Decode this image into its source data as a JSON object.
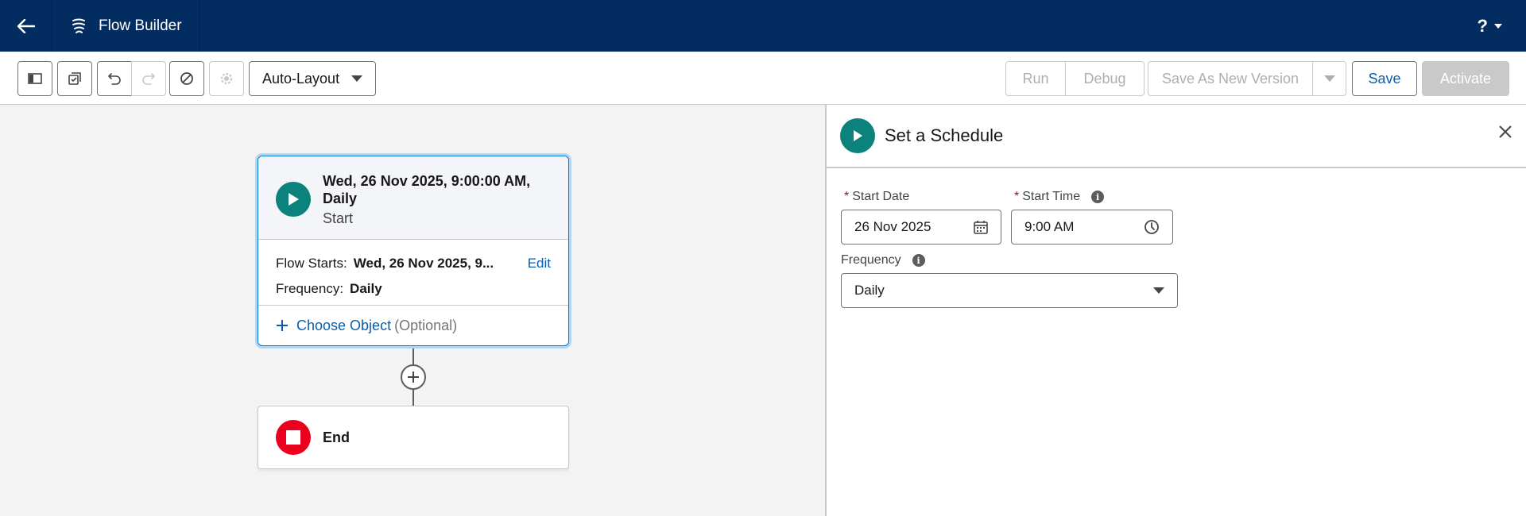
{
  "header": {
    "title": "Flow Builder",
    "help_label": "?"
  },
  "toolbar": {
    "layout_mode": "Auto-Layout",
    "run_label": "Run",
    "debug_label": "Debug",
    "save_as_new_label": "Save As New Version",
    "save_label": "Save",
    "activate_label": "Activate"
  },
  "canvas": {
    "start_card": {
      "title": "Wed, 26 Nov 2025, 9:00:00 AM, Daily",
      "subtitle": "Start",
      "flow_starts_label": "Flow Starts:",
      "flow_starts_value": "Wed, 26 Nov 2025, 9...",
      "edit_label": "Edit",
      "frequency_label": "Frequency:",
      "frequency_value": "Daily",
      "choose_object_label": "Choose Object",
      "choose_object_optional": "(Optional)"
    },
    "end_card": {
      "label": "End"
    }
  },
  "panel": {
    "title": "Set a Schedule",
    "start_date_label": "Start Date",
    "start_date_value": "26 Nov 2025",
    "start_time_label": "Start Time",
    "start_time_value": "9:00 AM",
    "frequency_label": "Frequency",
    "frequency_value": "Daily",
    "required_marker": "*"
  },
  "colors": {
    "header_bg": "#032d60",
    "brand_blue": "#0176d3",
    "link_blue": "#0b5cab",
    "start_green": "#0b827c",
    "end_red": "#ea001e"
  }
}
